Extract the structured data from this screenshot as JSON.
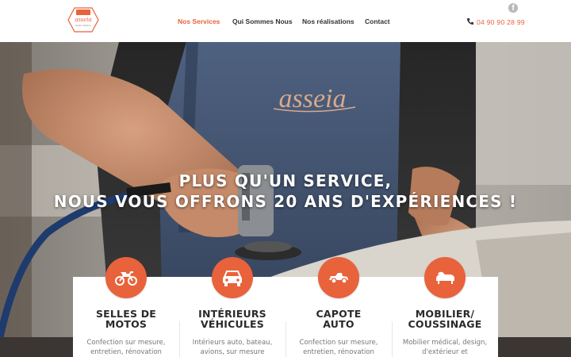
{
  "header": {
    "logo_text": "asseia",
    "logo_subtext": "Atelier Sellerie",
    "nav": [
      "Nos Services",
      "Qui Sommes Nous",
      "Nos réalisations",
      "Contact"
    ],
    "active_nav": "Nos Services",
    "social_icon": "facebook-icon",
    "phone_icon": "phone-icon",
    "phone": "04 90 90 28 99"
  },
  "hero": {
    "line1": "PLUS QU'UN SERVICE,",
    "line2": "NOUS VOUS OFFRONS 20 ANS D'EXPÉRIENCES !",
    "apron_text": "asseia"
  },
  "services": [
    {
      "icon": "motorcycle-icon",
      "title1": "SELLES DE",
      "title2": "MOTOS",
      "desc": "Confection sur mesure, entretien, rénovation"
    },
    {
      "icon": "car-interior-icon",
      "title1": "INTÉRIEURS",
      "title2": "VÉHICULES",
      "desc": "Intérieurs auto, bateau, avions, sur mesure"
    },
    {
      "icon": "convertible-car-icon",
      "title1": "CAPOTE",
      "title2": "AUTO",
      "desc": "Confection sur mesure, entretien, rénovation"
    },
    {
      "icon": "sofa-icon",
      "title1": "MOBILIER/",
      "title2": "COUSSINAGE",
      "desc": "Mobilier médical, design, d'extérieur et"
    }
  ],
  "colors": {
    "accent": "#e8623b",
    "text_dark": "#2a2a2a",
    "nav_text": "#333333"
  }
}
